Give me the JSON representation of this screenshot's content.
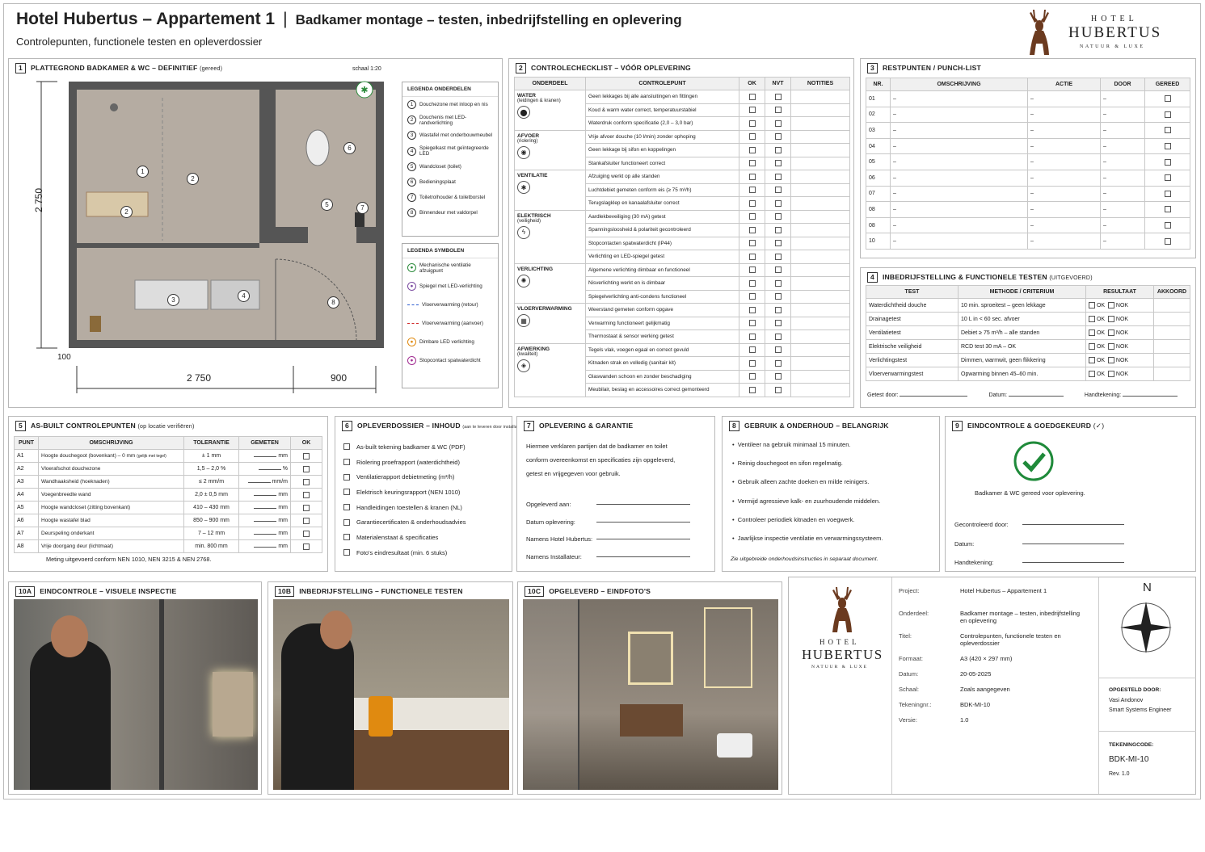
{
  "header": {
    "title": "Hotel Hubertus – Appartement 1",
    "separator": "|",
    "subtitle_main": "Badkamer montage – testen, inbedrijfstelling en oplevering",
    "subtitle": "Controlepunten, functionele testen en opleverdossier"
  },
  "logo": {
    "line1": "HOTEL",
    "line2": "HUBERTUS",
    "line3": "NATUUR & LUXE"
  },
  "s1": {
    "num": "1",
    "title": "PLATTEGROND BADKAMER & WC – DEFINITIEF",
    "tag": "(gereed)",
    "scale": "schaal 1:20",
    "dims": {
      "height": "2 750",
      "width_main": "2 750",
      "width_wc": "900",
      "offset": "100"
    },
    "legend_title": "LEGENDA ONDERDELEN",
    "legend": [
      {
        "n": "1",
        "t": "Douchezone met inloop en nis"
      },
      {
        "n": "2",
        "t": "Douchenis met LED-randverlichting"
      },
      {
        "n": "3",
        "t": "Wastafel met onderbouwmeubel"
      },
      {
        "n": "4",
        "t": "Spiegelkast met geïntegreerde LED"
      },
      {
        "n": "5",
        "t": "Wandcloset (toilet)"
      },
      {
        "n": "6",
        "t": "Bedieningsplaat"
      },
      {
        "n": "7",
        "t": "Toiletrolhouder & toiletborstel"
      },
      {
        "n": "8",
        "t": "Binnendeur met valdorpel"
      }
    ],
    "symbols_title": "LEGENDA SYMBOLEN",
    "symbols": [
      {
        "icon": "fan-icon",
        "t": "Mechanische ventilatie afzuigpunt",
        "c": "#2a8a3a"
      },
      {
        "icon": "mirror-led-icon",
        "t": "Spiegel met LED-verlichting",
        "c": "#7a4aa0"
      },
      {
        "icon": "dash-blue",
        "t": "Vloerverwarming (retour)",
        "c": "#2a5ad0"
      },
      {
        "icon": "dash-red",
        "t": "Vloerverwarming (aanvoer)",
        "c": "#d02a2a"
      },
      {
        "icon": "dimmable-led-icon",
        "t": "Dimbare LED verlichting",
        "c": "#e08a10"
      },
      {
        "icon": "socket-icon",
        "t": "Stopcontact spatwaterdicht",
        "c": "#a02a90"
      }
    ]
  },
  "s2": {
    "num": "2",
    "title": "CONTROLECHECKLIST – VÓÓR OPLEVERING",
    "cols": [
      "ONDERDEEL",
      "CONTROLEPUNT",
      "OK",
      "NVT",
      "NOTITIES"
    ],
    "groups": [
      {
        "name": "WATER",
        "sub": "(leidingen & kranen)",
        "icon": "water-icon",
        "items": [
          "Geen lekkages bij alle aansluitingen en fittingen",
          "Koud & warm water correct, temperatuurstabiel",
          "Waterdruk conform specificatie (2,0 – 3,0 bar)"
        ]
      },
      {
        "name": "AFVOER",
        "sub": "(riolering)",
        "icon": "drain-icon",
        "items": [
          "Vrije afvoer douche (10 l/min) zonder ophoping",
          "Geen lekkage bij sifon en koppelingen",
          "Stankafsluiter functioneert correct"
        ]
      },
      {
        "name": "VENTILATIE",
        "sub": "",
        "icon": "ventilation-icon",
        "items": [
          "Afzuiging werkt op alle standen",
          "Luchtdebiet gemeten conform eis (≥ 75 m³/h)",
          "Terugslagklep en kanaalafsluiter correct"
        ]
      },
      {
        "name": "ELEKTRISCH",
        "sub": "(veiligheid)",
        "icon": "electric-icon",
        "items": [
          "Aardlekbeveiliging (30 mA) getest",
          "Spanningsloosheid & polariteit gecontroleerd",
          "Stopcontacten spatwaterdicht (IP44)",
          "Verlichting en LED-spiegel getest"
        ]
      },
      {
        "name": "VERLICHTING",
        "sub": "",
        "icon": "light-icon",
        "items": [
          "Algemene verlichting dimbaar en functioneel",
          "Nisverlichting werkt en is dimbaar",
          "Spiegelverlichting anti-condens functioneel"
        ]
      },
      {
        "name": "VLOERVERWARMING",
        "sub": "",
        "icon": "floor-heating-icon",
        "items": [
          "Weerstand gemeten conform opgave",
          "Verwarming functioneert gelijkmatig",
          "Thermostaat & sensor werking getest"
        ]
      },
      {
        "name": "AFWERKING",
        "sub": "(kwaliteit)",
        "icon": "finish-icon",
        "items": [
          "Tegels vlak, voegen egaal en correct gevuld",
          "Kitnaden strak en volledig (sanitair kit)",
          "Glaswanden schoon en zonder beschadiging",
          "Meubilair, beslag en accessoires correct gemonteerd"
        ]
      }
    ]
  },
  "s3": {
    "num": "3",
    "title": "RESTPUNTEN / PUNCH-LIST",
    "cols": [
      "NR.",
      "OMSCHRIJVING",
      "ACTIE",
      "DOOR",
      "GEREED"
    ],
    "rows": [
      {
        "nr": "01",
        "d": "–",
        "a": "–",
        "b": "–"
      },
      {
        "nr": "02",
        "d": "–",
        "a": "–",
        "b": "–"
      },
      {
        "nr": "03",
        "d": "–",
        "a": "–",
        "b": "–"
      },
      {
        "nr": "04",
        "d": "–",
        "a": "–",
        "b": "–"
      },
      {
        "nr": "05",
        "d": "–",
        "a": "–",
        "b": "–"
      },
      {
        "nr": "06",
        "d": "–",
        "a": "–",
        "b": "–"
      },
      {
        "nr": "07",
        "d": "–",
        "a": "–",
        "b": "–"
      },
      {
        "nr": "08",
        "d": "–",
        "a": "–",
        "b": "–"
      },
      {
        "nr": "08",
        "d": "–",
        "a": "–",
        "b": "–"
      },
      {
        "nr": "10",
        "d": "–",
        "a": "–",
        "b": "–"
      }
    ]
  },
  "s4": {
    "num": "4",
    "title": "INBEDRIJFSTELLING & FUNCTIONELE TESTEN",
    "tag": "(UITGEVOERD)",
    "cols": [
      "TEST",
      "METHODE / CRITERIUM",
      "RESULTAAT",
      "AKKOORD"
    ],
    "rows": [
      {
        "t": "Waterdichtheid douche",
        "m": "10 min. sproeitest – geen lekkage"
      },
      {
        "t": "Drainagetest",
        "m": "10 L in < 60 sec. afvoer"
      },
      {
        "t": "Ventilatietest",
        "m": "Debiet ≥ 75 m³/h – alle standen"
      },
      {
        "t": "Elektrische veiligheid",
        "m": "RCD test 30 mA – OK"
      },
      {
        "t": "Verlichtingstest",
        "m": "Dimmen, warmwit, geen flikkering"
      },
      {
        "t": "Vloerverwarmingstest",
        "m": "Opwarming binnen 45–60 min."
      }
    ],
    "ok": "OK",
    "nok": "NOK",
    "tested_by": "Getest door:",
    "date": "Datum:",
    "signature": "Handtekening:"
  },
  "s5": {
    "num": "5",
    "title": "AS-BUILT CONTROLEPUNTEN",
    "tag": "(op locatie verifiëren)",
    "cols": [
      "PUNT",
      "OMSCHRIJVING",
      "TOLERANTIE",
      "GEMETEN",
      "OK"
    ],
    "rows": [
      {
        "p": "A1",
        "d": "Hoogte douchegoot (bovenkant) – 0 mm",
        "ds": "(gelijk met tegel)",
        "t": "± 1 mm",
        "u": "mm"
      },
      {
        "p": "A2",
        "d": "Vloerafschot douchezone",
        "ds": "",
        "t": "1,5 – 2,0 %",
        "u": "%"
      },
      {
        "p": "A3",
        "d": "Wandhaaksheid (hoeknaden)",
        "ds": "",
        "t": "≤ 2 mm/m",
        "u": "mm/m"
      },
      {
        "p": "A4",
        "d": "Voegenbreedte wand",
        "ds": "",
        "t": "2,0 ± 0,5 mm",
        "u": "mm"
      },
      {
        "p": "A5",
        "d": "Hoogte wandcloset (zitting bovenkant)",
        "ds": "",
        "t": "410 – 430 mm",
        "u": "mm"
      },
      {
        "p": "A6",
        "d": "Hoogte wastafel blad",
        "ds": "",
        "t": "850 – 900 mm",
        "u": "mm"
      },
      {
        "p": "A7",
        "d": "Deurspeling onderkant",
        "ds": "",
        "t": "7 – 12 mm",
        "u": "mm"
      },
      {
        "p": "A8",
        "d": "Vrije doorgang deur (lichtmaat)",
        "ds": "",
        "t": "min. 800 mm",
        "u": "mm"
      }
    ],
    "note": "Meting uitgevoerd conform NEN 1010, NEN 3215 & NEN 2768."
  },
  "s6": {
    "num": "6",
    "title": "OPLEVERDOSSIER – INHOUD",
    "tag": "(aan te leveren door installateur)",
    "items": [
      "As-built tekening badkamer & WC (PDF)",
      "Riolering proefrapport (waterdichtheid)",
      "Ventilatierapport debietmeting (m³/h)",
      "Elektrisch keuringsrapport (NEN 1010)",
      "Handleidingen toestellen & kranen (NL)",
      "Garantiecertificaten & onderhoudsadvies",
      "Materialenstaat & specificaties",
      "Foto's eindresultaat (min. 6 stuks)"
    ]
  },
  "s7": {
    "num": "7",
    "title": "OPLEVERING & GARANTIE",
    "text": [
      "Hiermee verklaren partijen dat de badkamer en toilet",
      "conform overeenkomst en specificaties zijn opgeleverd,",
      "getest en vrijgegeven voor gebruik."
    ],
    "fields": [
      "Opgeleverd aan:",
      "Datum oplevering:",
      "Namens Hotel Hubertus:",
      "Namens Installateur:"
    ]
  },
  "s8": {
    "num": "8",
    "title": "GEBRUIK & ONDERHOUD – BELANGRIJK",
    "items": [
      "Ventileer na gebruik minimaal 15 minuten.",
      "Reinig douchegoot en sifon regelmatig.",
      "Gebruik alleen zachte doeken en milde reinigers.",
      "Vermijd agressieve kalk- en zuurhoudende middelen.",
      "Controleer periodiek kitnaden en voegwerk.",
      "Jaarlijkse inspectie ventilatie en verwarmingssysteem."
    ],
    "note": "Zie uitgebreide onderhoudsinstructies in separaat document."
  },
  "s9": {
    "num": "9",
    "title": "EINDCONTROLE & GOEDGEKEURD",
    "tag": "(✓)",
    "text": "Badkamer & WC gereed voor oplevering.",
    "fields": [
      "Gecontroleerd door:",
      "Datum:",
      "Handtekening:"
    ]
  },
  "s10a": {
    "num": "10A",
    "title": "EINDCONTROLE – VISUELE INSPECTIE"
  },
  "s10b": {
    "num": "10B",
    "title": "INBEDRIJFSTELLING – FUNCTIONELE TESTEN"
  },
  "s10c": {
    "num": "10C",
    "title": "OPGELEVERD – EINDFOTO'S"
  },
  "titleblock": {
    "rows": [
      {
        "k": "Project:",
        "v": "Hotel Hubertus – Appartement 1"
      },
      {
        "k": "Onderdeel:",
        "v": "Badkamer montage – testen, inbedrijfstelling en oplevering"
      },
      {
        "k": "Titel:",
        "v": "Controlepunten, functionele testen en opleverdossier"
      },
      {
        "k": "Formaat:",
        "v": "A3 (420 × 297 mm)"
      },
      {
        "k": "Datum:",
        "v": "20-05-2025"
      },
      {
        "k": "Schaal:",
        "v": "Zoals aangegeven"
      },
      {
        "k": "Tekeningnr.:",
        "v": "BDK-MI-10"
      },
      {
        "k": "Versie:",
        "v": "1.0"
      }
    ],
    "north": "N",
    "drawn_by_label": "OPGESTELD DOOR:",
    "drawn_by": "Vasi Andonov",
    "role": "Smart Systems Engineer",
    "code_label": "TEKENINGCODE:",
    "code": "BDK-MI-10",
    "rev": "Rev.   1.0"
  }
}
